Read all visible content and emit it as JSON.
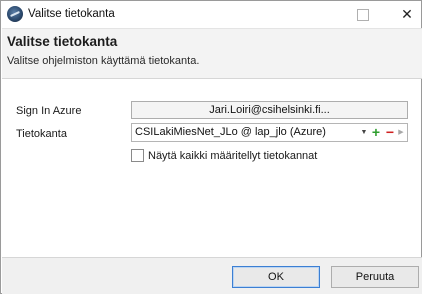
{
  "window": {
    "title": "Valitse tietokanta",
    "close_glyph": "✕"
  },
  "header": {
    "title": "Valitse tietokanta",
    "subtitle": "Valitse ohjelmiston käyttämä tietokanta."
  },
  "form": {
    "signin_label": "Sign In Azure",
    "signin_value": "Jari.Loiri@csihelsinki.fi...",
    "database_label": "Tietokanta",
    "database_value": "CSILakiMiesNet_JLo @ lap_jlo (Azure)",
    "show_all_label": "Näytä kaikki määritellyt tietokannat",
    "show_all_checked": false,
    "add_glyph": "+",
    "remove_glyph": "−",
    "dropdown_glyph": "▼",
    "more_glyph": "▶"
  },
  "footer": {
    "ok_label": "OK",
    "cancel_label": "Peruuta"
  },
  "colors": {
    "add": "#2e9e2e",
    "remove": "#d02020",
    "ok_border": "#3c7fd3"
  }
}
